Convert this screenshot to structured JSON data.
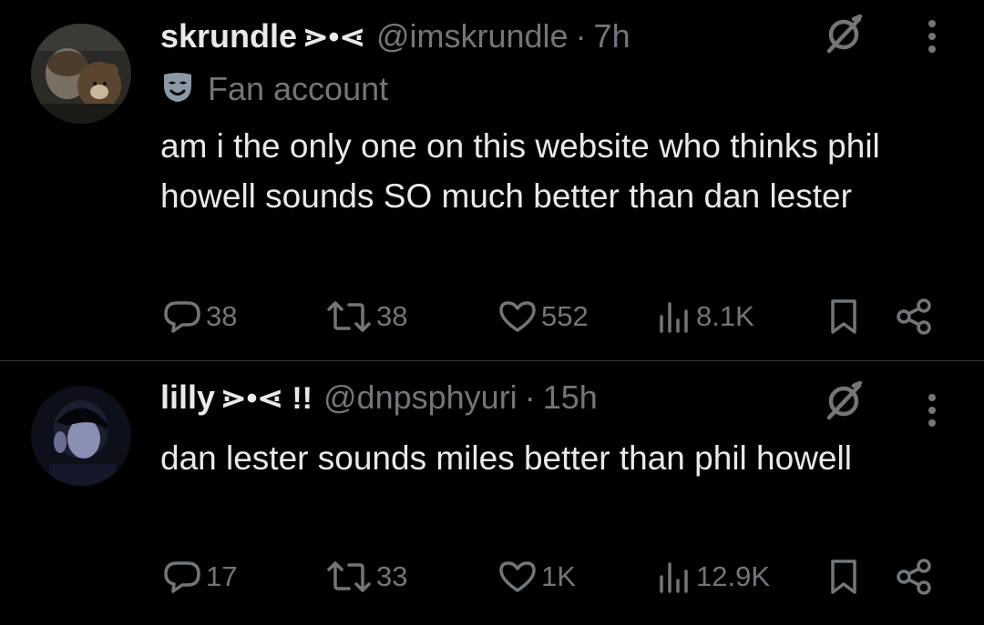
{
  "posts": [
    {
      "name": "skrundle",
      "name_emote": "⋗•⋖",
      "handle": "@imskrundle",
      "separator": "·",
      "time": "7h",
      "label": "Fan account",
      "text": "am i the only one on this website who thinks phil howell sounds SO much better than dan lester",
      "stats": {
        "replies": "38",
        "reposts": "38",
        "likes": "552",
        "views": "8.1K"
      }
    },
    {
      "name": "lilly",
      "name_emote": "⋗•⋖ !!",
      "handle": "@dnpsphyuri",
      "separator": "·",
      "time": "15h",
      "text": "dan lester sounds miles better than phil howell",
      "stats": {
        "replies": "17",
        "reposts": "33",
        "likes": "1K",
        "views": "12.9K"
      }
    }
  ],
  "icons": {
    "reply": "speech-bubble-icon",
    "repost": "repost-arrows-icon",
    "like": "heart-icon",
    "views": "bar-chart-icon",
    "bookmark": "bookmark-icon",
    "share": "share-icon",
    "grok": "grok-slash-icon",
    "more": "vertical-ellipsis-icon",
    "label": "mask-icon"
  },
  "colors": {
    "background": "#000000",
    "text": "#e7e9ea",
    "muted": "#71767b",
    "divider": "#2f3336"
  }
}
